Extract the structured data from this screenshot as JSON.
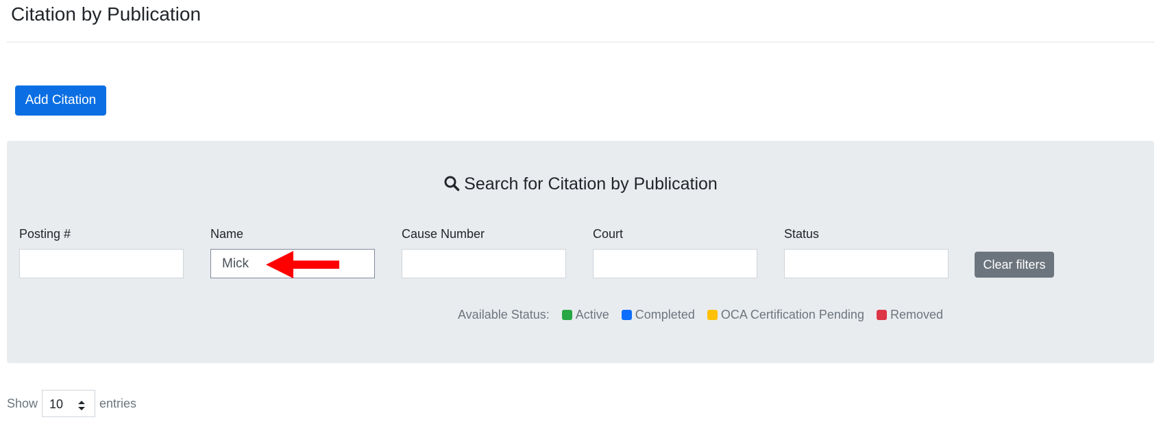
{
  "header": {
    "title": "Citation by Publication"
  },
  "toolbar": {
    "add_label": "Add Citation"
  },
  "search": {
    "heading": "Search for Citation by Publication",
    "fields": [
      {
        "label": "Posting #",
        "value": ""
      },
      {
        "label": "Name",
        "value": "Mick"
      },
      {
        "label": "Cause Number",
        "value": ""
      },
      {
        "label": "Court",
        "value": ""
      },
      {
        "label": "Status",
        "value": ""
      }
    ],
    "clear_label": "Clear filters",
    "status_legend": {
      "label": "Available Status:",
      "items": [
        {
          "label": "Active",
          "color": "#28a745"
        },
        {
          "label": "Completed",
          "color": "#0d6efd"
        },
        {
          "label": "OCA Certification Pending",
          "color": "#ffc107"
        },
        {
          "label": "Removed",
          "color": "#dc3545"
        }
      ]
    }
  },
  "annotation": {
    "arrow_color": "#ff0000"
  },
  "entries": {
    "show_label": "Show",
    "value": "10",
    "entries_label": "entries"
  }
}
